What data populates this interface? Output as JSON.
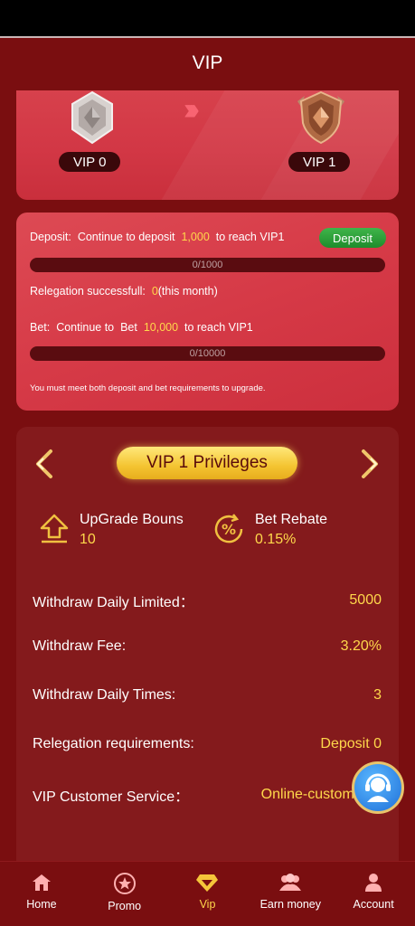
{
  "header": {
    "title": "VIP"
  },
  "vip_levels": {
    "current": "VIP 0",
    "next": "VIP 1"
  },
  "progress": {
    "deposit_prefix": "Deposit:",
    "deposit_text_1": "Continue to deposit",
    "deposit_amount": "1,000",
    "deposit_text_2": "to reach VIP1",
    "deposit_button": "Deposit",
    "deposit_progress": "0/1000",
    "deposit_progress_value": 0,
    "relegation_text": "Relegation successfull:",
    "relegation_count": "0",
    "relegation_suffix": "(this month)",
    "bet_prefix": "Bet:",
    "bet_text_1": "Continue to",
    "bet_text_2": "Bet",
    "bet_amount": "10,000",
    "bet_text_3": "to reach VIP1",
    "bet_progress": "0/10000",
    "bet_progress_value": 0,
    "note": "You must meet both deposit and bet requirements to upgrade."
  },
  "privileges": {
    "title": "VIP 1 Privileges",
    "upgrade_label": "UpGrade Bouns",
    "upgrade_value": "10",
    "rebate_label": "Bet Rebate",
    "rebate_value": "0.15%",
    "rows": [
      {
        "label": "Withdraw Daily Limited：",
        "value": "5000"
      },
      {
        "label": "Withdraw Fee:",
        "value": "3.20%"
      },
      {
        "label": "Withdraw Daily Times:",
        "value": "3"
      },
      {
        "label": "Relegation requirements:",
        "value": "Deposit 0"
      },
      {
        "label": "VIP Customer Service：",
        "value": "Online-customer"
      }
    ]
  },
  "nav": {
    "items": [
      {
        "label": "Home",
        "icon": "home-icon"
      },
      {
        "label": "Promo",
        "icon": "star-icon"
      },
      {
        "label": "Vip",
        "icon": "diamond-icon"
      },
      {
        "label": "Earn money",
        "icon": "users-icon"
      },
      {
        "label": "Account",
        "icon": "person-icon"
      }
    ],
    "active": "Vip"
  },
  "colors": {
    "background": "#7a0e10",
    "accent": "#ffd84b",
    "card": "#d23745",
    "button_green": "#2ea23a"
  }
}
